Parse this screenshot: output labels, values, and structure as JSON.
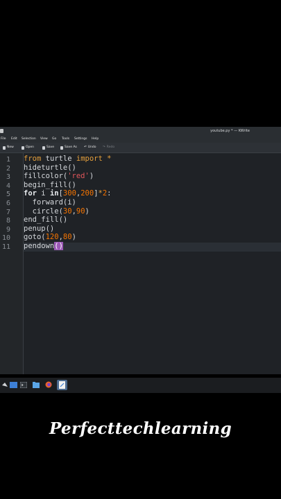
{
  "window": {
    "title": "youtube.py * — KWrite"
  },
  "menu": {
    "items": [
      "File",
      "Edit",
      "Selection",
      "View",
      "Go",
      "Tools",
      "Settings",
      "Help"
    ]
  },
  "toolbar": {
    "new": "New",
    "open": "Open",
    "save": "Save",
    "save_as": "Save As",
    "undo": "Undo",
    "redo": "Redo"
  },
  "editor": {
    "line_numbers": [
      "1",
      "2",
      "3",
      "4",
      "5",
      "6",
      "7",
      "8",
      "9",
      "10",
      "11"
    ],
    "lines": [
      "from turtle import *",
      "hideturtle()",
      "fillcolor('red')",
      "begin_fill()",
      "for i in[300,200]*2:",
      "  forward(i)",
      "  circle(30,90)",
      "end_fill()",
      "penup()",
      "goto(120,80)",
      "pendown()"
    ],
    "current_line": 11
  },
  "taskbar": {
    "icons": [
      "app-launcher-icon",
      "terminal-icon",
      "files-icon",
      "firefox-icon",
      "kwrite-icon"
    ]
  },
  "caption": "Perfecttechlearning"
}
